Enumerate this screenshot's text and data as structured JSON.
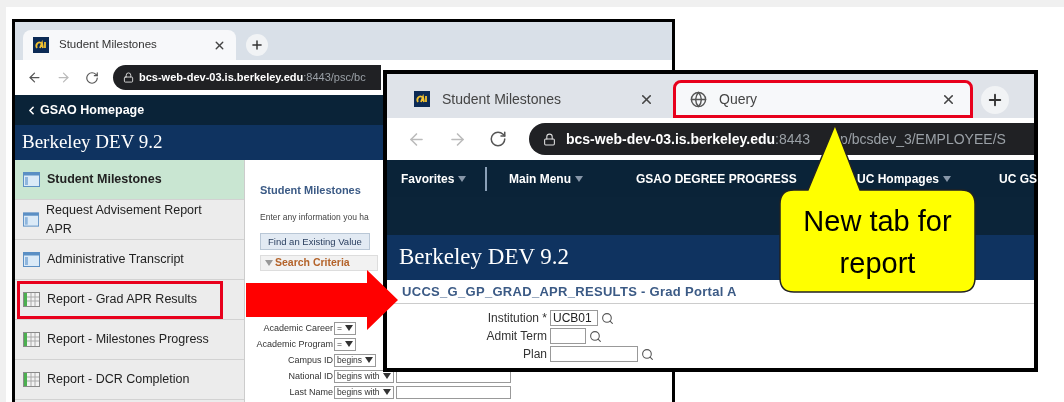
{
  "left_window": {
    "tab": {
      "title": "Student Milestones"
    },
    "url_host": "bcs-web-dev-03.is.berkeley.edu",
    "url_rest": ":8443/psc/bc",
    "back_link": "GSAO Homepage",
    "brand": "Berkeley DEV 9.2",
    "sidebar": [
      {
        "label": "Student Milestones",
        "kind": "page",
        "selected": true,
        "highlighted": false
      },
      {
        "label": "Request Advisement Report APR",
        "kind": "page",
        "selected": false,
        "highlighted": false
      },
      {
        "label": "Administrative Transcript",
        "kind": "page",
        "selected": false,
        "highlighted": false
      },
      {
        "label": "Report - Grad APR Results",
        "kind": "report",
        "selected": false,
        "highlighted": true
      },
      {
        "label": "Report - Milestones Progress",
        "kind": "report",
        "selected": false,
        "highlighted": false
      },
      {
        "label": "Report - DCR Completion",
        "kind": "report",
        "selected": false,
        "highlighted": false
      }
    ],
    "panel": {
      "title": "Student Milestones",
      "hint": "Enter any information you ha",
      "tab": "Find an Existing Value",
      "section": "Search Criteria",
      "fields": [
        {
          "label": "Academic Career",
          "operator": "=",
          "input": false
        },
        {
          "label": "Academic Program",
          "operator": "=",
          "input": false
        },
        {
          "label": "Campus ID",
          "operator": "begins",
          "input": false
        },
        {
          "label": "National ID",
          "operator": "begins with",
          "input": true
        },
        {
          "label": "Last Name",
          "operator": "begins with",
          "input": true
        }
      ]
    }
  },
  "right_window": {
    "tabs": [
      {
        "title": "Student Milestones",
        "kind": "cal",
        "selected": false,
        "highlighted": false
      },
      {
        "title": "Query",
        "kind": "globe",
        "selected": true,
        "highlighted": true
      }
    ],
    "url_parts": [
      "bcs-web-dev-03.is.berkeley.edu",
      ":8443",
      "p/bcsdev_3/EMPLOYEE/S"
    ],
    "menu": [
      {
        "label": "Favorites",
        "dropdown": true
      },
      {
        "label": "Main Menu",
        "dropdown": true
      },
      {
        "label": "GSAO DEGREE PROGRESS",
        "dropdown": false
      },
      {
        "label": "UC Hompages",
        "dropdown": true
      },
      {
        "label": "UC GS",
        "dropdown": false
      }
    ],
    "brand": "Berkeley DEV 9.2",
    "title": "UCCS_G_GP_GRAD_APR_RESULTS - Grad Portal A",
    "fields": [
      {
        "label": "Institution *",
        "value": "UCB01"
      },
      {
        "label": "Admit Term"
      },
      {
        "label": "Plan"
      }
    ]
  },
  "callout": {
    "text": "New tab for report"
  }
}
